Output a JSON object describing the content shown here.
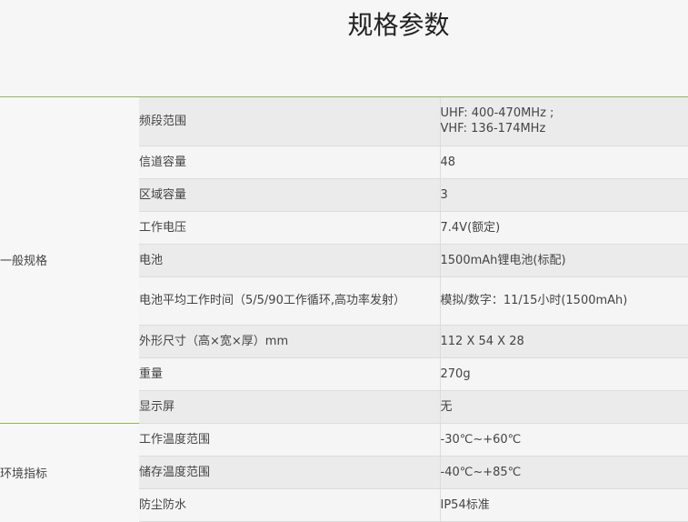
{
  "page": {
    "title": "规格参数"
  },
  "groups": [
    {
      "category": "一般规格",
      "rows": [
        {
          "name": "频段范围",
          "value_lines": [
            "UHF: 400-470MHz ;",
            "VHF: 136-174MHz"
          ]
        },
        {
          "name": "信道容量",
          "value": "48"
        },
        {
          "name": "区域容量",
          "value": "3"
        },
        {
          "name": "工作电压",
          "value": "7.4V(额定)"
        },
        {
          "name": "电池",
          "value": "1500mAh锂电池(标配)"
        },
        {
          "name": "电池平均工作时间（5/5/90工作循环,高功率发射）",
          "value": "模拟/数字：11/15小时(1500mAh)"
        },
        {
          "name": "外形尺寸（高×宽×厚）mm",
          "value": "112 X 54 X 28"
        },
        {
          "name": "重量",
          "value": "270g"
        },
        {
          "name": "显示屏",
          "value": "无"
        }
      ]
    },
    {
      "category": "环境指标",
      "rows": [
        {
          "name": "工作温度范围",
          "value": "-30℃~+60℃"
        },
        {
          "name": "储存温度范围",
          "value": "-40℃~+85℃"
        },
        {
          "name": "防尘防水",
          "value": "IP54标准"
        }
      ]
    }
  ]
}
